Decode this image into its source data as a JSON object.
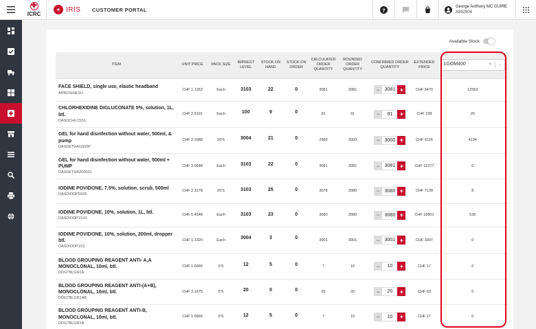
{
  "header": {
    "org_name": "ICRC",
    "app_name": "IRIS",
    "portal_title": "CUSTOMER PORTAL",
    "user_name": "George Anthony MC GUIRE",
    "user_id": "A892904"
  },
  "sidebar": {
    "items": [
      {
        "icon": "dashboard-icon",
        "active": false
      },
      {
        "icon": "checklist-icon",
        "active": false
      },
      {
        "icon": "truck-icon",
        "active": false
      },
      {
        "icon": "catalog-icon",
        "active": false
      },
      {
        "icon": "medical-icon",
        "active": true
      },
      {
        "icon": "store-icon",
        "active": false
      },
      {
        "icon": "list-icon",
        "active": false
      },
      {
        "icon": "search-icon",
        "active": false
      },
      {
        "icon": "print-icon",
        "active": false
      },
      {
        "icon": "globe-icon",
        "active": false
      }
    ]
  },
  "controls": {
    "available_stock_label": "Available Stock",
    "warehouse_selected": "1GOM400"
  },
  "table": {
    "headers": {
      "item": "ITEM",
      "unit_price": "UNIT PRICE",
      "pack_size": "PACK SIZE",
      "imprest": "IMPREST LEVEL",
      "stock_on_hand": "STOCK ON HAND",
      "stock_on_order": "STOCK ON ORDER",
      "calc_qty": "CALCULATED ORDER QUANTITY",
      "rounded_qty": "ROUNDED ORDER QUANTITY",
      "confirmed_qty": "CONFIRMED ORDER QUANTITY",
      "extended_price": "EXTENDED PRICE"
    },
    "rows": [
      {
        "name": "FACE SHIELD, single use, elastic headband",
        "code": "APROSHIESU",
        "unit_price": "CHF 1.1262",
        "pack": "Each",
        "imprest": "3103",
        "on_hand": "22",
        "on_order": "0",
        "calc": "3081",
        "rounded": "3081",
        "confirmed": "3081",
        "extended": "CHF 3470",
        "stock": "12553"
      },
      {
        "name": "CHLORHEXIDINE DIGLUCONATE 5%, solution, 1L, btl.",
        "code": "DASDCHLC5S1",
        "unit_price": "CHF 2.6191",
        "pack": "Each",
        "imprest": "100",
        "on_hand": "9",
        "on_order": "0",
        "calc": "91",
        "rounded": "91",
        "confirmed": "91",
        "extended": "CHF 238",
        "stock": "26"
      },
      {
        "name": "GEL for hand disinfection without water, 500ml, & pump",
        "code": "DASDETHAG500P",
        "unit_price": "CHF 2.0388",
        "pack": "20'S",
        "imprest": "3004",
        "on_hand": "21",
        "on_order": "0",
        "calc": "2983",
        "rounded": "3000",
        "confirmed": "3000",
        "extended": "CHF 6116",
        "stock": "4134"
      },
      {
        "name": "GEL for hand disinfection without water, 500ml + PUMP",
        "code": "DASDETHAZ00001",
        "unit_price": "CHF 3.9648",
        "pack": "Each",
        "imprest": "3103",
        "on_hand": "22",
        "on_order": "0",
        "calc": "3081",
        "rounded": "3081",
        "confirmed": "3081",
        "extended": "CHF 12277",
        "stock": "0"
      },
      {
        "name": "IODINE POVIDONE, 7.5%, solution, scrub, 500ml",
        "code": "DASDIODP5S05",
        "unit_price": "CHF 2.3178",
        "pack": "20'S",
        "imprest": "3103",
        "on_hand": "25",
        "on_order": "0",
        "calc": "3078",
        "rounded": "3080",
        "confirmed": "3080",
        "extended": "CHF 7139",
        "stock": "8"
      },
      {
        "name": "IODINE POVIDONE, 10%, solution, 1L, btl.",
        "code": "DASDIODP1S10",
        "unit_price": "CHF 5.4548",
        "pack": "Each",
        "imprest": "3103",
        "on_hand": "23",
        "on_order": "0",
        "calc": "3080",
        "rounded": "3080",
        "confirmed": "3080",
        "extended": "CHF 16801",
        "stock": "536"
      },
      {
        "name": "IODINE POVIDONE, 10%, solution, 200ml, dropper btl.",
        "code": "DASDIODP1S2",
        "unit_price": "CHF 1.1320",
        "pack": "Each",
        "imprest": "3004",
        "on_hand": "3",
        "on_order": "0",
        "calc": "3001",
        "rounded": "3001",
        "confirmed": "3001",
        "extended": "CHF 3397",
        "stock": "0"
      },
      {
        "name": "BLOOD GROUPING REAGENT ANTI- A,A MONOCLONAL, 10ml, btl.",
        "code": "DDGTBLGR1A",
        "unit_price": "CHF 1.6666",
        "pack": "5'S",
        "imprest": "12",
        "on_hand": "5",
        "on_order": "0",
        "calc": "7",
        "rounded": "10",
        "confirmed": "10",
        "extended": "CHF 17",
        "stock": "0"
      },
      {
        "name": "BLOOD GROUPING REAGENT ANTI-(A+B), MONOCLONAL, 10ml, btl.",
        "code": "DDGTBLGR1AB",
        "unit_price": "CHF 3.1675",
        "pack": "5'S",
        "imprest": "20",
        "on_hand": "0",
        "on_order": "0",
        "calc": "20",
        "rounded": "20",
        "confirmed": "20",
        "extended": "CHF 63",
        "stock": "0"
      },
      {
        "name": "BLOOD GROUPING REAGENT ANTI-B, MONOCLONAL, 10ml, btl.",
        "code": "DDGTBLGR1B",
        "unit_price": "CHF 1.6666",
        "pack": "5'S",
        "imprest": "12",
        "on_hand": "5",
        "on_order": "0",
        "calc": "7",
        "rounded": "10",
        "confirmed": "10",
        "extended": "CHF 17",
        "stock": "0"
      }
    ]
  },
  "colors": {
    "brand_red": "#c8102e",
    "highlight": "#e2001a",
    "sidebar_bg": "#2f3640"
  }
}
